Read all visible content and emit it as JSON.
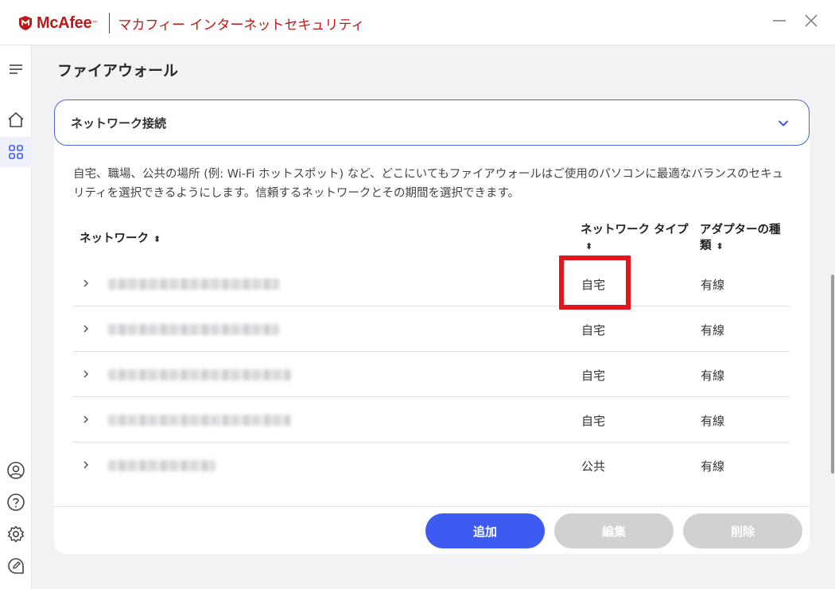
{
  "app": {
    "brand": "McAfee",
    "trademark": "™",
    "product_name": "マカフィー インターネットセキュリティ",
    "brand_color": "#c01818"
  },
  "page": {
    "title": "ファイアウォール"
  },
  "section": {
    "title": "ネットワーク接続",
    "description": "自宅、職場、公共の場所 (例: Wi-Fi ホットスポット) など、どこにいてもファイアウォールはご使用のパソコンに最適なバランスのセキュリティを選択できるようにします。信頼するネットワークとその期間を選択できます。"
  },
  "table": {
    "headers": {
      "network": "ネットワーク",
      "type": "ネットワーク タイプ",
      "adapter": "アダプターの種類"
    },
    "rows": [
      {
        "type": "自宅",
        "adapter": "有線"
      },
      {
        "type": "自宅",
        "adapter": "有線"
      },
      {
        "type": "自宅",
        "adapter": "有線"
      },
      {
        "type": "自宅",
        "adapter": "有線"
      },
      {
        "type": "公共",
        "adapter": "有線"
      }
    ]
  },
  "buttons": {
    "add": "追加",
    "edit": "編集",
    "delete": "削除"
  },
  "colors": {
    "accent": "#3d5af1",
    "disabled": "#d3d0d0",
    "highlight": "#e3141c"
  }
}
